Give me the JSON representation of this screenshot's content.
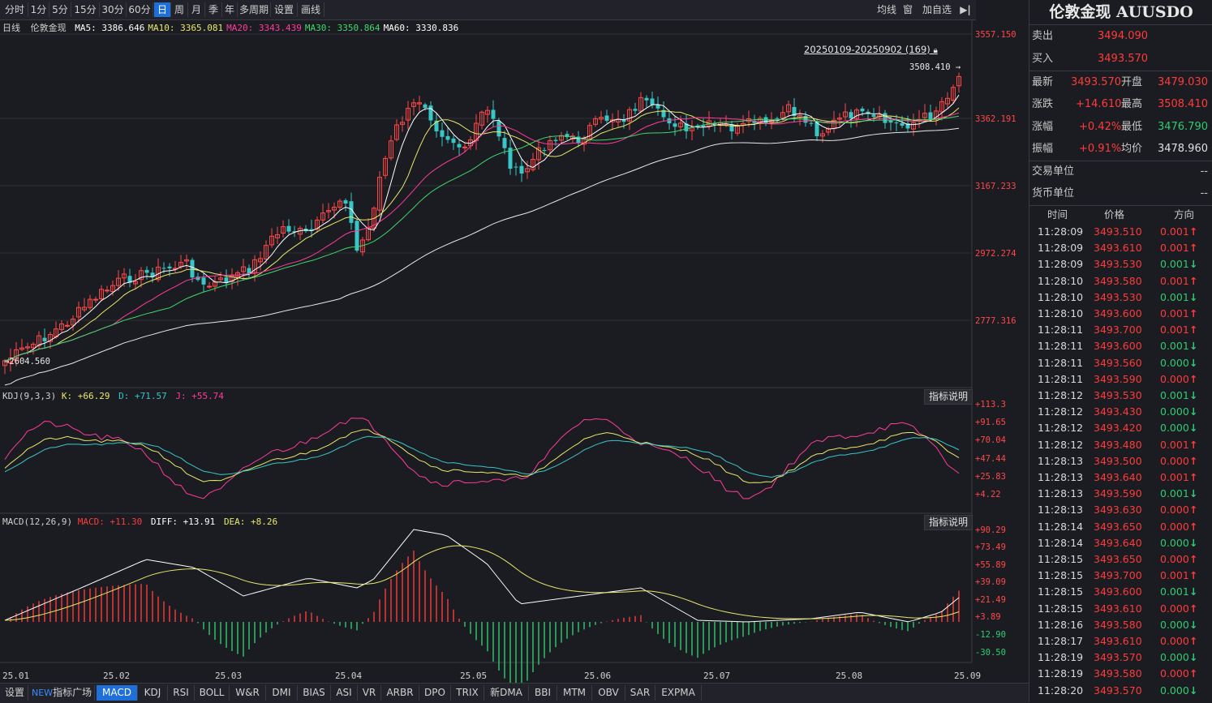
{
  "toolbar": {
    "periods": [
      "分时",
      "1分",
      "5分",
      "15分",
      "30分",
      "60分",
      "日",
      "周",
      "月",
      "季",
      "年",
      "多周期",
      "设置",
      "画线"
    ],
    "active_period": "日",
    "right": {
      "ma_label": "均线",
      "window_label": "窗",
      "add_watch_label": "加自选",
      "nav_symbol": "▶|"
    }
  },
  "main_chart": {
    "label": "日线",
    "name": "伦敦金现",
    "ma": [
      {
        "label": "MA5:",
        "value": "3386.646",
        "color": "#ffffff"
      },
      {
        "label": "MA10:",
        "value": "3365.081",
        "color": "#e8e86a"
      },
      {
        "label": "MA20:",
        "value": "3343.439",
        "color": "#ff3b9a"
      },
      {
        "label": "MA30:",
        "value": "3350.864",
        "color": "#3fd86a"
      },
      {
        "label": "MA60:",
        "value": "3330.836",
        "color": "#ffffff"
      }
    ],
    "range_label": "20250109-20250902 (169)",
    "high_label": "3508.410",
    "low_label": "2604.560",
    "price_ticks": [
      "3557.150",
      "3362.191",
      "3167.233",
      "2972.274",
      "2777.316"
    ]
  },
  "kdj": {
    "label": "KDJ(9,3,3)",
    "k": "K: +66.29",
    "d": "D: +71.57",
    "j": "J: +55.74",
    "explain_label": "指标说明",
    "ticks": [
      "+113.3",
      "+91.65",
      "+70.04",
      "+47.44",
      "+25.83",
      "+4.22"
    ]
  },
  "macd": {
    "label": "MACD(12,26,9)",
    "macd": "MACD: +11.30",
    "diff": "DIFF: +13.91",
    "dea": "DEA: +8.26",
    "explain_label": "指标说明",
    "ticks": [
      "+90.29",
      "+73.49",
      "+55.89",
      "+39.09",
      "+21.49",
      "+3.89",
      "-12.90",
      "-30.50"
    ]
  },
  "x_axis": [
    "25.01",
    "25.02",
    "25.03",
    "25.04",
    "25.05",
    "25.06",
    "25.07",
    "25.08",
    "25.09"
  ],
  "bottom_tabs": [
    "设置",
    "指标广场",
    "MACD",
    "KDJ",
    "RSI",
    "BOLL",
    "W&R",
    "DMI",
    "BIAS",
    "ASI",
    "VR",
    "ARBR",
    "DPO",
    "TRIX",
    "新DMA",
    "BBI",
    "MTM",
    "OBV",
    "SAR",
    "EXPMA"
  ],
  "new_badge": "NEW",
  "active_tab": "MACD",
  "quote": {
    "title": "伦敦金现 AUUSDO",
    "sell_label": "卖出",
    "sell_value": "3494.090",
    "buy_label": "买入",
    "buy_value": "3493.570",
    "latest_label": "最新",
    "latest_value": "3493.570",
    "open_label": "开盘",
    "open_value": "3479.030",
    "change_label": "涨跌",
    "change_value": "+14.610",
    "high_label": "最高",
    "high_value": "3508.410",
    "pct_label": "涨幅",
    "pct_value": "+0.42%",
    "low_label": "最低",
    "low_value": "3476.790",
    "amp_label": "振幅",
    "amp_value": "+0.91%",
    "avg_label": "均价",
    "avg_value": "3478.960",
    "unit_label": "交易单位",
    "unit_value": "--",
    "currency_label": "货币单位",
    "currency_value": "--"
  },
  "trades": {
    "headers": [
      "时间",
      "价格",
      "方向"
    ],
    "rows": [
      {
        "time": "11:28:09",
        "price": "3493.510",
        "vol": "0.001",
        "dir": "up"
      },
      {
        "time": "11:28:09",
        "price": "3493.610",
        "vol": "0.001",
        "dir": "up"
      },
      {
        "time": "11:28:09",
        "price": "3493.530",
        "vol": "0.001",
        "dir": "down"
      },
      {
        "time": "11:28:10",
        "price": "3493.580",
        "vol": "0.001",
        "dir": "up"
      },
      {
        "time": "11:28:10",
        "price": "3493.530",
        "vol": "0.001",
        "dir": "down"
      },
      {
        "time": "11:28:10",
        "price": "3493.600",
        "vol": "0.001",
        "dir": "up"
      },
      {
        "time": "11:28:11",
        "price": "3493.700",
        "vol": "0.001",
        "dir": "up"
      },
      {
        "time": "11:28:11",
        "price": "3493.600",
        "vol": "0.001",
        "dir": "down"
      },
      {
        "time": "11:28:11",
        "price": "3493.560",
        "vol": "0.000",
        "dir": "down"
      },
      {
        "time": "11:28:11",
        "price": "3493.590",
        "vol": "0.000",
        "dir": "up"
      },
      {
        "time": "11:28:12",
        "price": "3493.530",
        "vol": "0.001",
        "dir": "down"
      },
      {
        "time": "11:28:12",
        "price": "3493.430",
        "vol": "0.000",
        "dir": "down"
      },
      {
        "time": "11:28:12",
        "price": "3493.420",
        "vol": "0.000",
        "dir": "down"
      },
      {
        "time": "11:28:12",
        "price": "3493.480",
        "vol": "0.001",
        "dir": "up"
      },
      {
        "time": "11:28:13",
        "price": "3493.500",
        "vol": "0.000",
        "dir": "up"
      },
      {
        "time": "11:28:13",
        "price": "3493.640",
        "vol": "0.001",
        "dir": "up"
      },
      {
        "time": "11:28:13",
        "price": "3493.590",
        "vol": "0.001",
        "dir": "down"
      },
      {
        "time": "11:28:13",
        "price": "3493.630",
        "vol": "0.000",
        "dir": "up"
      },
      {
        "time": "11:28:14",
        "price": "3493.650",
        "vol": "0.000",
        "dir": "up"
      },
      {
        "time": "11:28:14",
        "price": "3493.640",
        "vol": "0.000",
        "dir": "down"
      },
      {
        "time": "11:28:15",
        "price": "3493.650",
        "vol": "0.000",
        "dir": "up"
      },
      {
        "time": "11:28:15",
        "price": "3493.700",
        "vol": "0.001",
        "dir": "up"
      },
      {
        "time": "11:28:15",
        "price": "3493.600",
        "vol": "0.001",
        "dir": "down"
      },
      {
        "time": "11:28:15",
        "price": "3493.610",
        "vol": "0.000",
        "dir": "up"
      },
      {
        "time": "11:28:16",
        "price": "3493.580",
        "vol": "0.000",
        "dir": "down"
      },
      {
        "time": "11:28:17",
        "price": "3493.610",
        "vol": "0.000",
        "dir": "up"
      },
      {
        "time": "11:28:19",
        "price": "3493.570",
        "vol": "0.000",
        "dir": "down"
      },
      {
        "time": "11:28:19",
        "price": "3493.580",
        "vol": "0.000",
        "dir": "up"
      },
      {
        "time": "11:28:20",
        "price": "3493.570",
        "vol": "0.000",
        "dir": "down"
      }
    ]
  },
  "colors": {
    "up": "#ff3b3b",
    "down": "#2ecc71",
    "accent": "#1e6fd9",
    "candle_up": "#ff4848",
    "candle_down": "#38c6c6"
  }
}
